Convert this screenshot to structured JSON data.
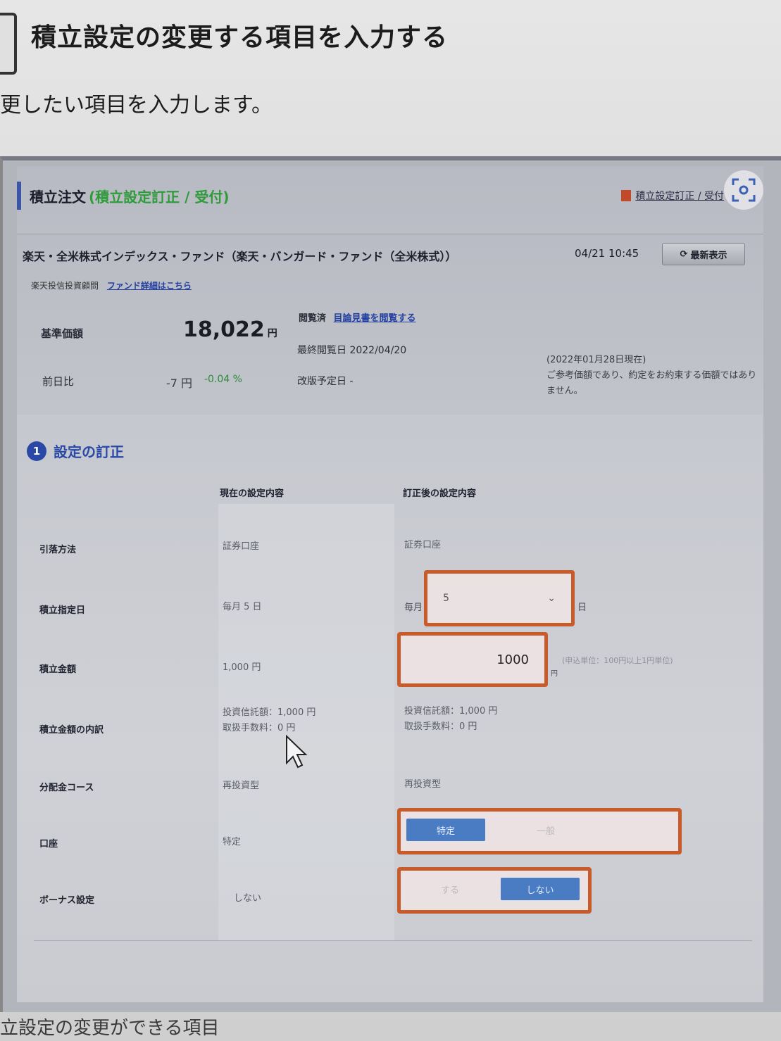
{
  "document": {
    "title": "積立設定の変更する項目を入力する",
    "lead": "更したい項目を入力します。",
    "footer": "立設定の変更ができる項目"
  },
  "screen": {
    "header": {
      "title": "積立注文",
      "subtitle": "(積立設定訂正 / 受付)",
      "link": "積立設定訂正 / 受付"
    },
    "fund": {
      "name": "楽天・全米株式インデックス・ファンド（楽天・バンガード・ファンド（全米株式））",
      "company": "楽天投信投資顧問",
      "detail_link": "ファンド詳細はこちら",
      "timestamp": "04/21 10:45",
      "refresh_label": "最新表示",
      "nav_label": "基準価額",
      "nav_value": "18,022",
      "nav_unit": "円",
      "diff_label": "前日比",
      "diff_yen": "-7 円",
      "diff_pct": "-0.04 %",
      "doc_status": "閲覧済",
      "doc_link": "目論見書を閲覧する",
      "last_view": "最終閲覧日 2022/04/20",
      "next_revision": "改版予定日 -",
      "note_date": "(2022年01月28日現在)",
      "note_text": "ご参考価額であり、約定をお約束する価額ではありません。"
    },
    "section": {
      "number": "1",
      "title": "設定の訂正"
    },
    "table": {
      "col_current": "現在の設定内容",
      "col_new": "訂正後の設定内容",
      "rows": [
        {
          "label": "引落方法",
          "current": "証券口座",
          "new": "証券口座"
        },
        {
          "label": "積立指定日",
          "current": "毎月 5 日",
          "prefix": "毎月",
          "select_value": "5",
          "suffix": "日"
        },
        {
          "label": "積立金額",
          "current": "1,000 円",
          "input_value": "1000",
          "unit": "円",
          "hint": "(申込単位：100円以上1円単位)"
        },
        {
          "label": "積立金額の内訳",
          "current_line1": "投資信託額：1,000 円",
          "current_line2": "取扱手数料：0 円",
          "new_line1": "投資信託額：1,000 円",
          "new_line2": "取扱手数料：0 円"
        },
        {
          "label": "分配金コース",
          "current": "再投資型",
          "new": "再投資型"
        },
        {
          "label": "口座",
          "current": "特定",
          "option_selected": "特定",
          "option_other": "一般"
        },
        {
          "label": "ボーナス設定",
          "current": "しない",
          "option_other": "する",
          "option_selected": "しない"
        }
      ]
    }
  },
  "colors": {
    "highlight": "#c95a2a",
    "accent_blue": "#2a49a6",
    "selected_segment": "#4a7cc4",
    "subtitle_green": "#2f9b3a"
  }
}
